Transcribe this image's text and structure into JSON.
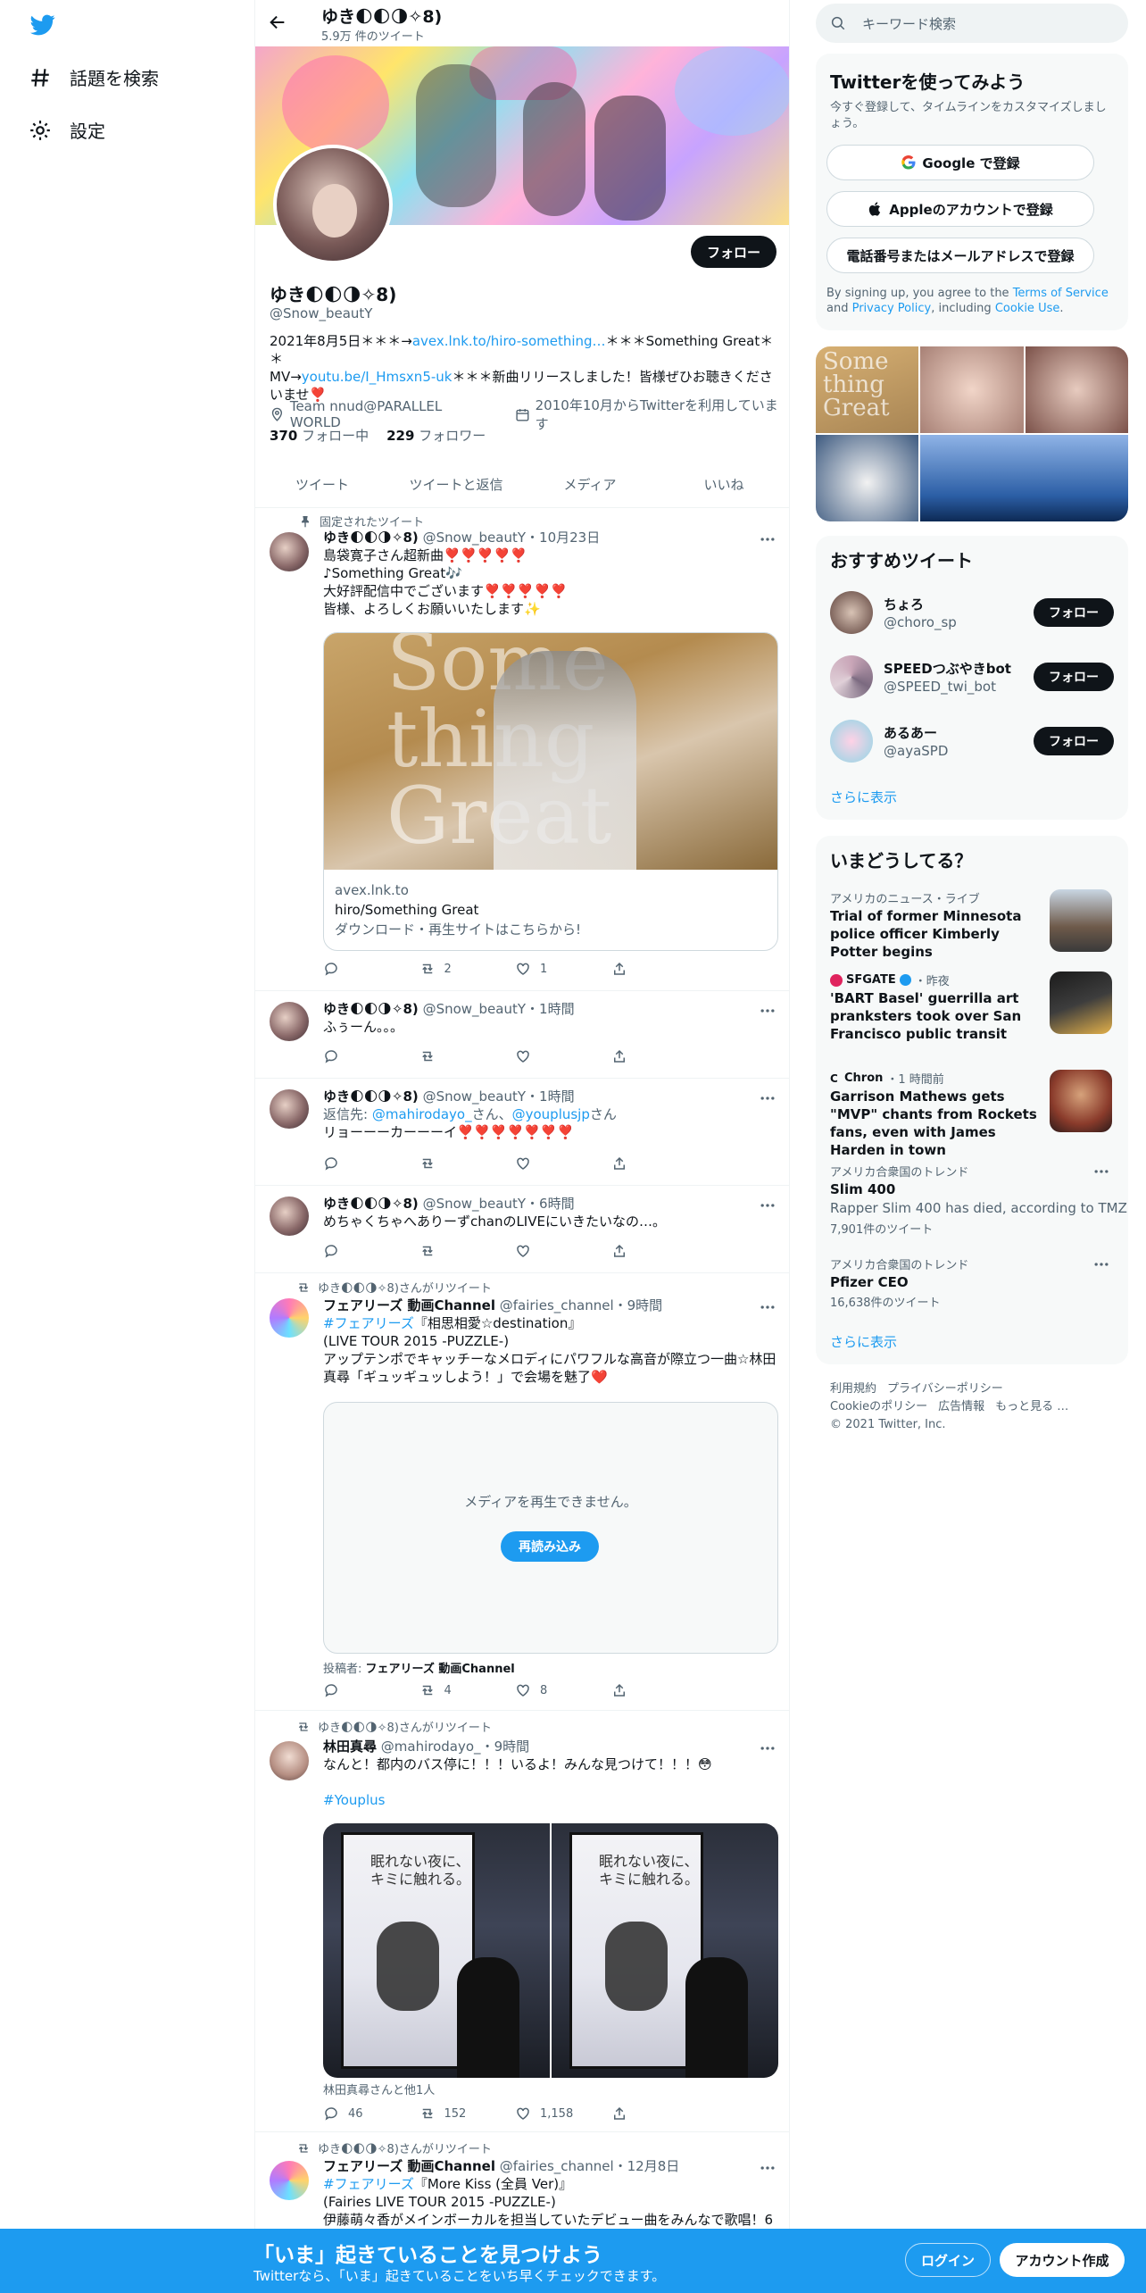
{
  "nav": {
    "explore_label": "話題を検索",
    "settings_label": "設定"
  },
  "header": {
    "name": "ゆき🌓🌓🌗✧8)",
    "tweet_count": "5.9万 件のツイート"
  },
  "profile": {
    "follow_label": "フォロー",
    "name": "ゆき🌓🌓🌗✧8)",
    "handle": "@Snow_beautY",
    "bio_1": "2021年8月5日＊＊＊→",
    "bio_link_1": "avex.lnk.to/hiro-something…",
    "bio_2": "＊＊＊Something Great＊＊",
    "bio_3": "MV→",
    "bio_link_2": "youtu.be/I_Hmsxn5-uk",
    "bio_4": "＊＊＊新曲リリースしました！皆様ぜひお聴きくださいませ❣️",
    "location": "Team nnud@PARALLEL WORLD",
    "joined": "2010年10月からTwitterを利用しています",
    "following_count": "370",
    "following_label": "フォロー中",
    "followers_count": "229",
    "followers_label": "フォロワー"
  },
  "tabs": [
    "ツイート",
    "ツイートと返信",
    "メディア",
    "いいね"
  ],
  "tweets": [
    {
      "context": "固定されたツイート",
      "name": "ゆき🌓🌓🌗✧8)",
      "handle": "@Snow_beautY",
      "time": "10月23日",
      "text": "島袋寛子さん超新曲❣️❣️❣️❣️❣️\n♪Something Great🎶\n大好評配信中でございます❣️❣️❣️❣️❣️\n皆様、よろしくお願いいたします✨",
      "card_domain": "avex.lnk.to",
      "card_title": "hiro/Something Great",
      "card_desc": "ダウンロード・再生サイトはこちらから!",
      "card_image_text": "Some\nthing\nGreat",
      "retweets": "2",
      "likes": "1"
    },
    {
      "name": "ゆき🌓🌓🌗✧8)",
      "handle": "@Snow_beautY",
      "time": "1時間",
      "text": "ふぅーん。。。"
    },
    {
      "name": "ゆき🌓🌓🌗✧8)",
      "handle": "@Snow_beautY",
      "time": "1時間",
      "reply_prefix": "返信先: ",
      "reply_1": "@mahirodayo_",
      "reply_mid": "さん、",
      "reply_2": "@youplusjp",
      "reply_suffix": "さん",
      "text": "リョーーーカーーーイ❣️❣️❣️❣️❣️❣️❣️"
    },
    {
      "name": "ゆき🌓🌓🌗✧8)",
      "handle": "@Snow_beautY",
      "time": "6時間",
      "text": "めちゃくちゃへありーずchanのLIVEにいきたいなの…。"
    },
    {
      "context": "ゆき🌓🌓🌗✧8)さんがリツイート",
      "name": "フェアリーズ 動画Channel",
      "handle": "@fairies_channel",
      "time": "9時間",
      "hashtag": "#フェアリーズ",
      "text_after_tag": "『相思相愛☆destination』",
      "text": "(LIVE TOUR 2015 -PUZZLE-)\nアップテンポでキャッチーなメロディにパワフルな高音が際立つ一曲☆林田真尋「ギュッギュッしよう！」で会場を魅了❤️",
      "media_error": "メディアを再生できません。",
      "reload_label": "再読み込み",
      "posted_by_label": "投稿者: ",
      "posted_by": "フェアリーズ 動画Channel",
      "retweets": "4",
      "likes": "8"
    },
    {
      "context": "ゆき🌓🌓🌗✧8)さんがリツイート",
      "name": "林田真尋",
      "handle": "@mahirodayo_",
      "time": "9時間",
      "text": "なんと！都内のバス停に！！！いるよ！みんな見つけて！！！😳",
      "hashtag": "#Youplus",
      "photo_text": "眠れない夜に、\nキミに触れる。",
      "tagged": "林田真尋さんと他1人",
      "replies": "46",
      "retweets": "152",
      "likes": "1,158"
    },
    {
      "context": "ゆき🌓🌓🌗✧8)さんがリツイート",
      "name": "フェアリーズ 動画Channel",
      "handle": "@fairies_channel",
      "time": "12月8日",
      "hashtag": "#フェアリーズ",
      "text_after_tag": "『More Kiss (全員 Ver)』",
      "text": "(Fairies LIVE TOUR 2015 -PUZZLE-)\n伊藤萌々香がメインボーカルを担当していたデビュー曲をみんなで歌唱！6"
    }
  ],
  "sidebar": {
    "search_placeholder": "キーワード検索",
    "signup": {
      "title": "Twitterを使ってみよう",
      "subtitle": "今すぐ登録して、タイムラインをカスタマイズしましょう。",
      "google": "Google で登録",
      "apple": "Appleのアカウントで登録",
      "phone": "電話番号またはメールアドレスで登録",
      "terms_1": "By signing up, you agree to the ",
      "terms_link_1": "Terms of Service",
      "terms_2": " and ",
      "terms_link_2": "Privacy Policy",
      "terms_3": ", including ",
      "terms_link_3": "Cookie Use",
      "terms_4": "."
    },
    "grid_text": "Some\nthing\nGreat",
    "recommended": {
      "title": "おすすめツイート",
      "follow_label": "フォロー",
      "users": [
        {
          "name": "ちょろ",
          "handle": "@choro_sp"
        },
        {
          "name": "SPEEDつぶやきbot",
          "handle": "@SPEED_twi_bot"
        },
        {
          "name": "あるあー",
          "handle": "@ayaSPD"
        }
      ],
      "show_more": "さらに表示"
    },
    "trends": {
      "title": "いまどうしてる？",
      "items": [
        {
          "category": "アメリカのニュース・ライブ",
          "title": "Trial of former Minnesota police officer Kimberly Potter begins"
        },
        {
          "category_source": "SFGATE",
          "category_time": "・昨夜",
          "title": "'BART Basel' guerrilla art pranksters took over San Francisco public transit"
        },
        {
          "category_source": "Chron",
          "category_time": "・1 時間前",
          "title": "Garrison Mathews gets \"MVP\" chants from Rockets fans, even with James Harden in town"
        },
        {
          "category": "アメリカ合衆国のトレンド",
          "title": "Slim 400",
          "subtitle": "Rapper Slim 400 has died, according to TMZ",
          "count": "7,901件のツイート"
        },
        {
          "category": "アメリカ合衆国のトレンド",
          "title": "Pfizer CEO",
          "count": "16,638件のツイート"
        }
      ],
      "show_more": "さらに表示"
    },
    "footer": {
      "terms": "利用規約",
      "privacy": "プライバシーポリシー",
      "cookie": "Cookieのポリシー",
      "ads": "広告情報",
      "more": "もっと見る …",
      "copyright": "© 2021 Twitter, Inc."
    }
  },
  "bottombar": {
    "title": "「いま」起きていることを見つけよう",
    "subtitle": "Twitterなら、「いま」起きていることをいち早くチェックできます。",
    "login": "ログイン",
    "signup": "アカウント作成"
  },
  "colors": {
    "accent": "#1d9bf0",
    "text": "#0f1419",
    "secondary": "#536471"
  }
}
